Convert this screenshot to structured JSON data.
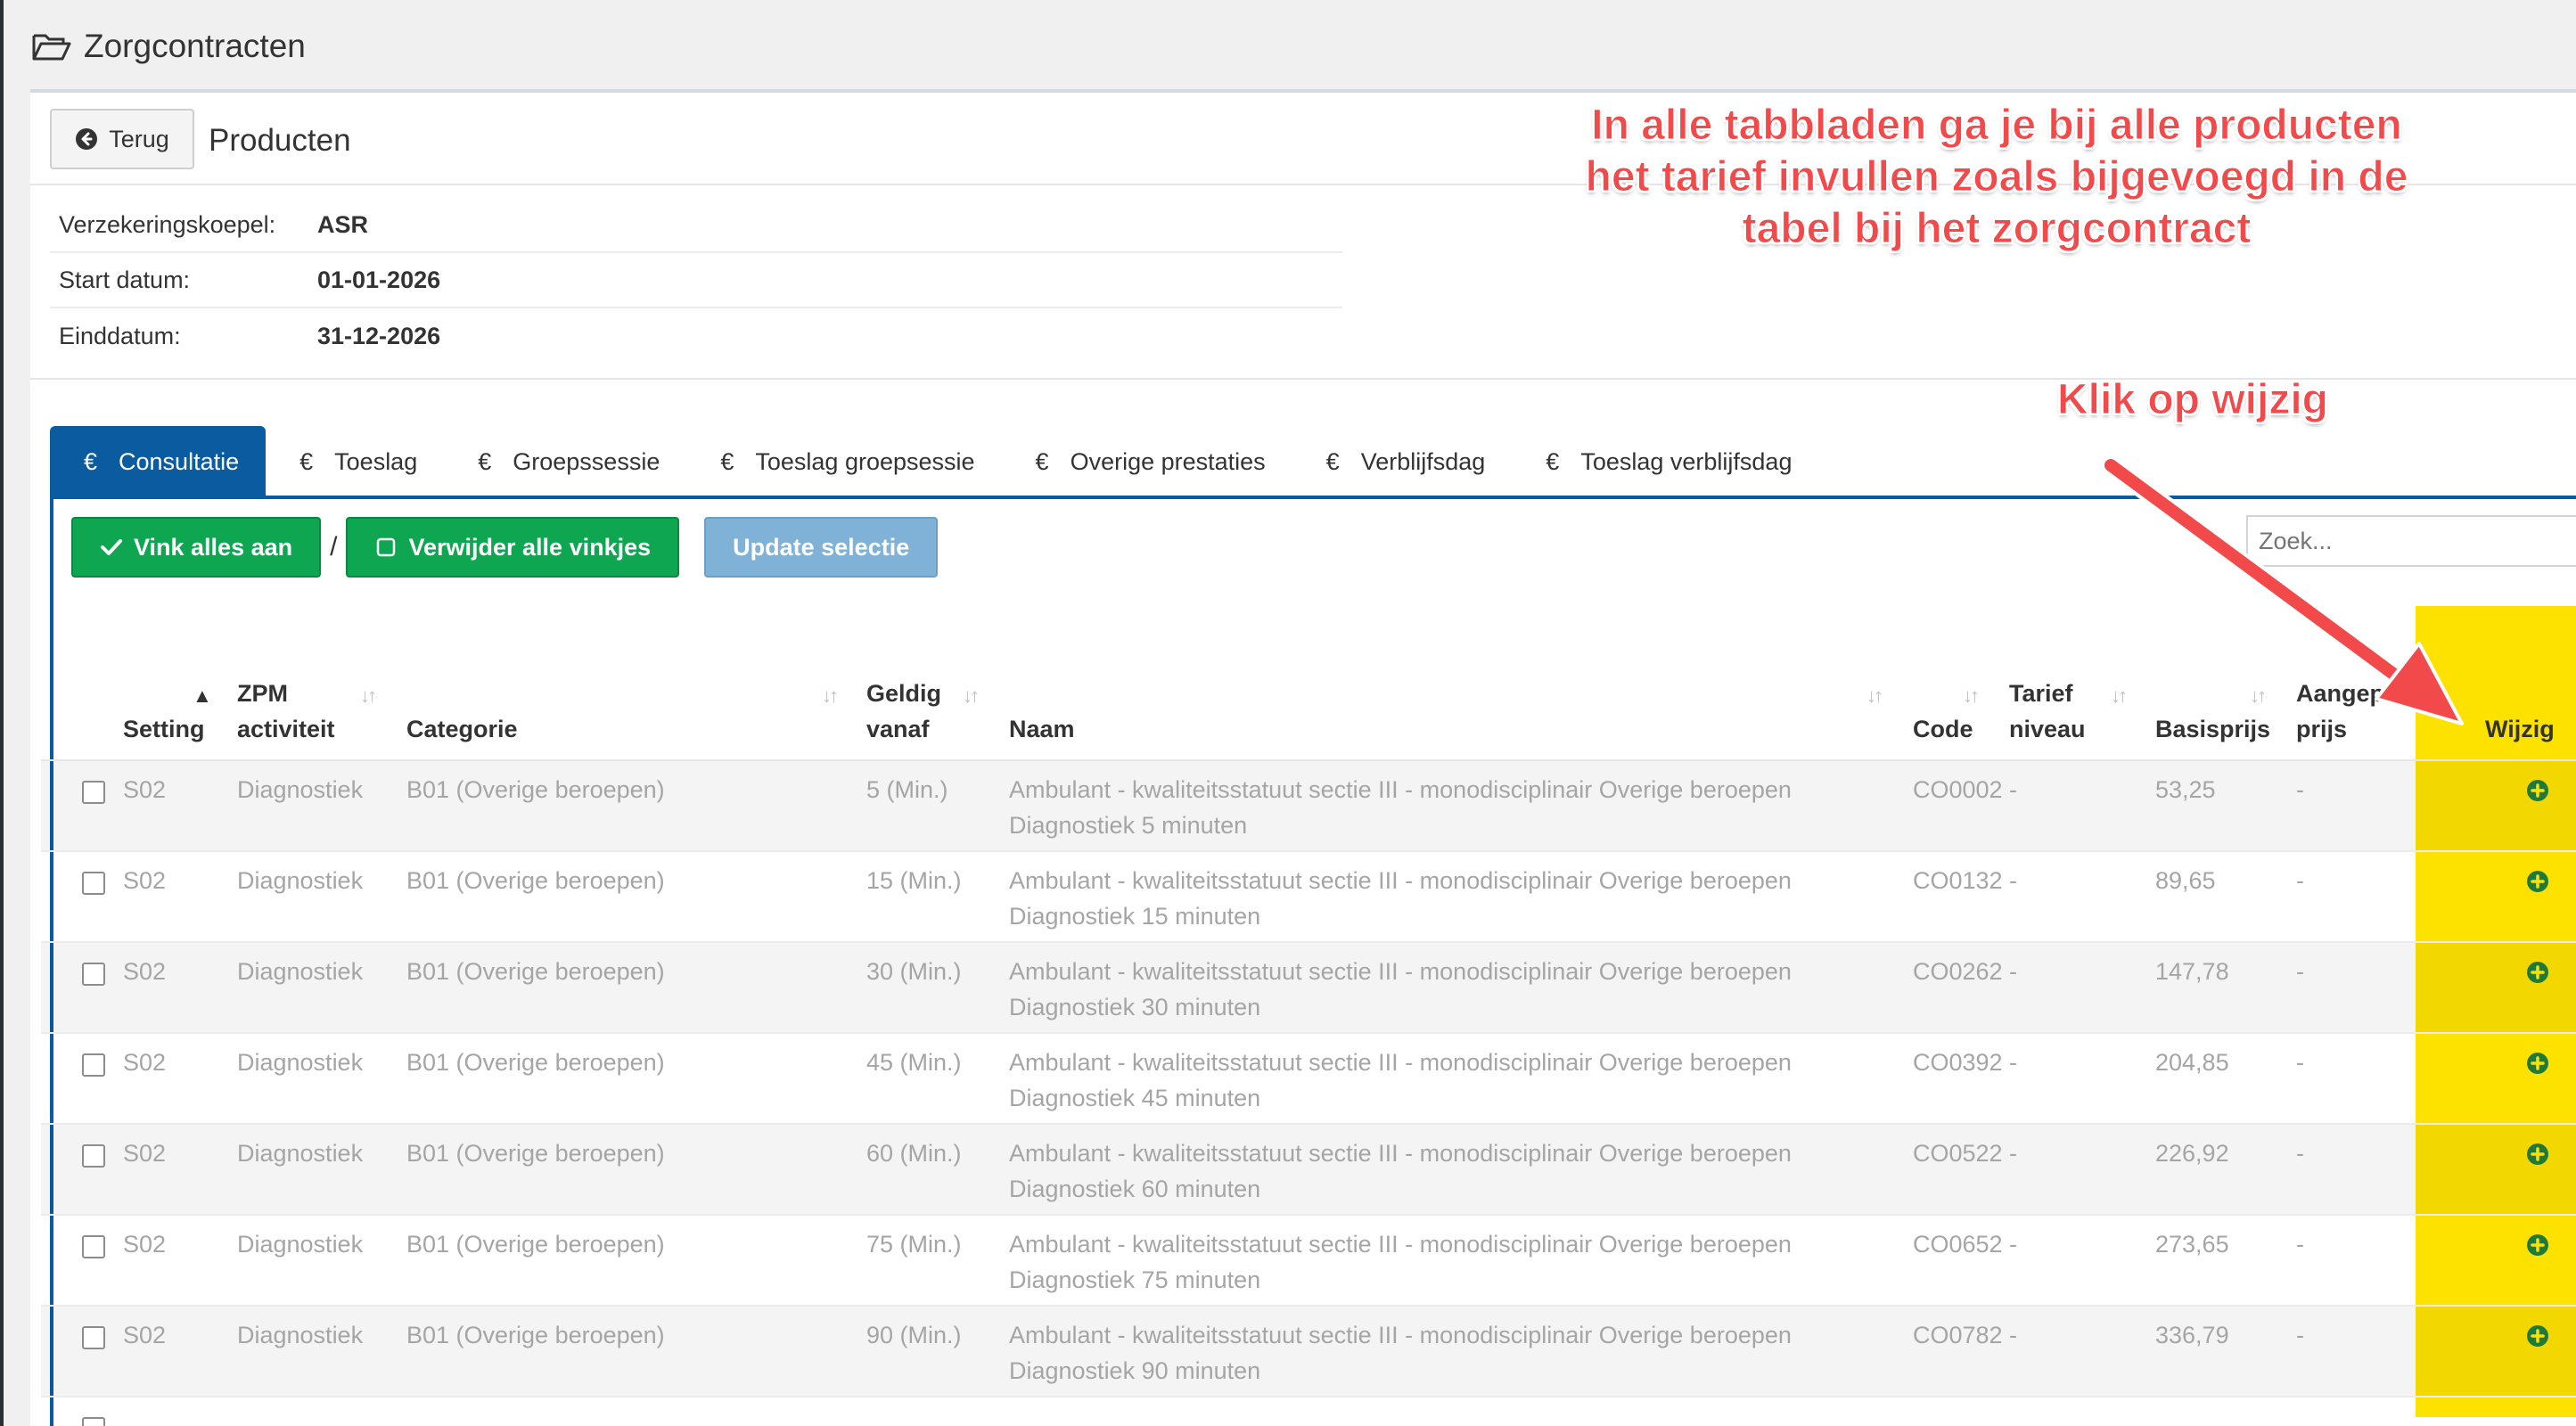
{
  "page": {
    "title": "Zorgcontracten"
  },
  "panel": {
    "back_label": "Terug",
    "title": "Producten"
  },
  "info": [
    {
      "label": "Verzekeringskoepel:",
      "value": "ASR"
    },
    {
      "label": "Start datum:",
      "value": "01-01-2026"
    },
    {
      "label": "Einddatum:",
      "value": "31-12-2026"
    }
  ],
  "tabs": [
    {
      "label": "Consultatie",
      "active": true
    },
    {
      "label": "Toeslag"
    },
    {
      "label": "Groepssessie"
    },
    {
      "label": "Toeslag groepsessie"
    },
    {
      "label": "Overige prestaties"
    },
    {
      "label": "Verblijfsdag"
    },
    {
      "label": "Toeslag verblijfsdag"
    }
  ],
  "tab_currency_symbol": "€",
  "actions": {
    "check_all": "Vink alles aan",
    "separator": "/",
    "uncheck_all": "Verwijder alle vinkjes",
    "update": "Update selectie"
  },
  "search": {
    "placeholder": "Zoek..."
  },
  "table": {
    "headers": {
      "setting": "Setting",
      "zpm_1": "ZPM",
      "zpm_2": "activiteit",
      "categorie": "Categorie",
      "geldig_1": "Geldig",
      "geldig_2": "vanaf",
      "naam": "Naam",
      "code": "Code",
      "tarief_1": "Tarief",
      "tarief_2": "niveau",
      "basisprijs": "Basisprijs",
      "aangepast_1": "Aangepaste",
      "aangepast_2": "prijs",
      "wijzig": "Wijzig"
    },
    "rows": [
      {
        "setting": "S02",
        "zpm": "Diagnostiek",
        "categorie": "B01 (Overige beroepen)",
        "geldig": "5 (Min.)",
        "naam_1": "Ambulant - kwaliteitsstatuut sectie III - monodisciplinair Overige beroepen",
        "naam_2": "Diagnostiek 5 minuten",
        "code": "CO0002",
        "tarief": "-",
        "basisprijs": "53,25",
        "aangepast": "-"
      },
      {
        "setting": "S02",
        "zpm": "Diagnostiek",
        "categorie": "B01 (Overige beroepen)",
        "geldig": "15 (Min.)",
        "naam_1": "Ambulant - kwaliteitsstatuut sectie III - monodisciplinair Overige beroepen",
        "naam_2": "Diagnostiek 15 minuten",
        "code": "CO0132",
        "tarief": "-",
        "basisprijs": "89,65",
        "aangepast": "-"
      },
      {
        "setting": "S02",
        "zpm": "Diagnostiek",
        "categorie": "B01 (Overige beroepen)",
        "geldig": "30 (Min.)",
        "naam_1": "Ambulant - kwaliteitsstatuut sectie III - monodisciplinair Overige beroepen",
        "naam_2": "Diagnostiek 30 minuten",
        "code": "CO0262",
        "tarief": "-",
        "basisprijs": "147,78",
        "aangepast": "-"
      },
      {
        "setting": "S02",
        "zpm": "Diagnostiek",
        "categorie": "B01 (Overige beroepen)",
        "geldig": "45 (Min.)",
        "naam_1": "Ambulant - kwaliteitsstatuut sectie III - monodisciplinair Overige beroepen",
        "naam_2": "Diagnostiek 45 minuten",
        "code": "CO0392",
        "tarief": "-",
        "basisprijs": "204,85",
        "aangepast": "-"
      },
      {
        "setting": "S02",
        "zpm": "Diagnostiek",
        "categorie": "B01 (Overige beroepen)",
        "geldig": "60 (Min.)",
        "naam_1": "Ambulant - kwaliteitsstatuut sectie III - monodisciplinair Overige beroepen",
        "naam_2": "Diagnostiek 60 minuten",
        "code": "CO0522",
        "tarief": "-",
        "basisprijs": "226,92",
        "aangepast": "-"
      },
      {
        "setting": "S02",
        "zpm": "Diagnostiek",
        "categorie": "B01 (Overige beroepen)",
        "geldig": "75 (Min.)",
        "naam_1": "Ambulant - kwaliteitsstatuut sectie III - monodisciplinair Overige beroepen",
        "naam_2": "Diagnostiek 75 minuten",
        "code": "CO0652",
        "tarief": "-",
        "basisprijs": "273,65",
        "aangepast": "-"
      },
      {
        "setting": "S02",
        "zpm": "Diagnostiek",
        "categorie": "B01 (Overige beroepen)",
        "geldig": "90 (Min.)",
        "naam_1": "Ambulant - kwaliteitsstatuut sectie III - monodisciplinair Overige beroepen",
        "naam_2": "Diagnostiek 90 minuten",
        "code": "CO0782",
        "tarief": "-",
        "basisprijs": "336,79",
        "aangepast": "-"
      }
    ]
  },
  "annotations": {
    "instruction": "In alle tabbladen ga je bij alle producten het tarief invullen zoals bijgevoegd in de tabel bij het zorgcontract",
    "click_hint": "Klik op wijzig"
  },
  "colors": {
    "primary": "#0b5ba1",
    "success": "#0ea650",
    "disabled_button": "#7fb2d6",
    "highlight": "#fde200",
    "annotation": "#f2494b"
  }
}
